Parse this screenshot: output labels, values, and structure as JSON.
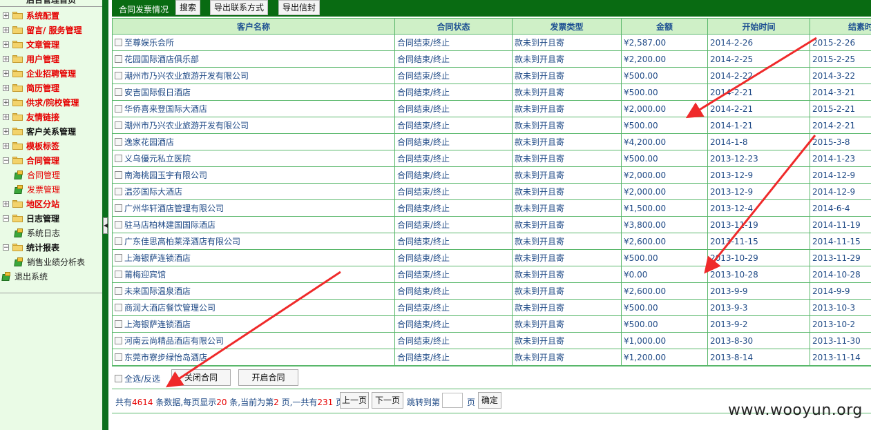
{
  "sidebar": {
    "top_title": "后台管理首页",
    "items": [
      {
        "label": "系统配置",
        "expanded": false,
        "color": "red"
      },
      {
        "label": "留言/ 服务管理",
        "expanded": false,
        "color": "red"
      },
      {
        "label": "文章管理",
        "expanded": false,
        "color": "red"
      },
      {
        "label": "用户管理",
        "expanded": false,
        "color": "red"
      },
      {
        "label": "企业招聘管理",
        "expanded": false,
        "color": "red"
      },
      {
        "label": "简历管理",
        "expanded": false,
        "color": "red"
      },
      {
        "label": "供求/院校管理",
        "expanded": false,
        "color": "red"
      },
      {
        "label": "友情链接",
        "expanded": false,
        "color": "red"
      },
      {
        "label": "客户关系管理",
        "expanded": false,
        "color": "black"
      },
      {
        "label": "模板标签",
        "expanded": false,
        "color": "red"
      },
      {
        "label": "合同管理",
        "expanded": true,
        "color": "red",
        "children": [
          {
            "label": "合同管理",
            "color": "red"
          },
          {
            "label": "发票管理",
            "color": "red"
          }
        ]
      },
      {
        "label": "地区分站",
        "expanded": false,
        "color": "red"
      },
      {
        "label": "日志管理",
        "expanded": true,
        "color": "black",
        "children": [
          {
            "label": "系统日志",
            "color": "black"
          }
        ]
      },
      {
        "label": "统计报表",
        "expanded": true,
        "color": "black",
        "children": [
          {
            "label": "销售业绩分析表",
            "color": "black"
          }
        ]
      }
    ],
    "logout": "退出系统"
  },
  "toolbar": {
    "title": "合同发票情况",
    "search_label": "搜索",
    "export_contacts_label": "导出联系方式",
    "export_envelope_label": "导出信封"
  },
  "table": {
    "columns": [
      "客户名称",
      "合同状态",
      "发票类型",
      "金额",
      "开始时间",
      "结素时"
    ],
    "rows": [
      [
        "至尊娱乐会所",
        "合同结束/终止",
        "款未到开且寄",
        "¥2,587.00",
        "2014-2-26",
        "2015-2-26"
      ],
      [
        "花园国际酒店俱乐部",
        "合同结束/终止",
        "款未到开且寄",
        "¥2,200.00",
        "2014-2-25",
        "2015-2-25"
      ],
      [
        "潮州市乃兴农业旅游开发有限公司",
        "合同结束/终止",
        "款未到开且寄",
        "¥500.00",
        "2014-2-22",
        "2014-3-22"
      ],
      [
        "安吉国际假日酒店",
        "合同结束/终止",
        "款未到开且寄",
        "¥500.00",
        "2014-2-21",
        "2014-3-21"
      ],
      [
        "华侨喜来登国际大酒店",
        "合同结束/终止",
        "款未到开且寄",
        "¥2,000.00",
        "2014-2-21",
        "2015-2-21"
      ],
      [
        "潮州市乃兴农业旅游开发有限公司",
        "合同结束/终止",
        "款未到开且寄",
        "¥500.00",
        "2014-1-21",
        "2014-2-21"
      ],
      [
        "逸家花园酒店",
        "合同结束/终止",
        "款未到开且寄",
        "¥4,200.00",
        "2014-1-8",
        "2015-3-8"
      ],
      [
        "义乌優元私立医院",
        "合同结束/终止",
        "款未到开且寄",
        "¥500.00",
        "2013-12-23",
        "2014-1-23"
      ],
      [
        "南海桃园玉宇有限公司",
        "合同结束/终止",
        "款未到开且寄",
        "¥2,000.00",
        "2013-12-9",
        "2014-12-9"
      ],
      [
        "温莎国际大酒店",
        "合同结束/终止",
        "款未到开且寄",
        "¥2,000.00",
        "2013-12-9",
        "2014-12-9"
      ],
      [
        "广州华轩酒店管理有限公司",
        "合同结束/终止",
        "款未到开且寄",
        "¥1,500.00",
        "2013-12-4",
        "2014-6-4"
      ],
      [
        "驻马店柏林建国国际酒店",
        "合同结束/终止",
        "款未到开且寄",
        "¥3,800.00",
        "2013-11-19",
        "2014-11-19"
      ],
      [
        "广东佳思高柏莱泽酒店有限公司",
        "合同结束/终止",
        "款未到开且寄",
        "¥2,600.00",
        "2013-11-15",
        "2014-11-15"
      ],
      [
        "上海银萨连锁酒店",
        "合同结束/终止",
        "款未到开且寄",
        "¥500.00",
        "2013-10-29",
        "2013-11-29"
      ],
      [
        "莆梅迎宾馆",
        "合同结束/终止",
        "款未到开且寄",
        "¥0.00",
        "2013-10-28",
        "2014-10-28"
      ],
      [
        "未来国际温泉酒店",
        "合同结束/终止",
        "款未到开且寄",
        "¥2,600.00",
        "2013-9-9",
        "2014-9-9"
      ],
      [
        "商润大酒店餐饮管理公司",
        "合同结束/终止",
        "款未到开且寄",
        "¥500.00",
        "2013-9-3",
        "2013-10-3"
      ],
      [
        "上海银萨连锁酒店",
        "合同结束/终止",
        "款未到开且寄",
        "¥500.00",
        "2013-9-2",
        "2013-10-2"
      ],
      [
        "河南云尚精品酒店有限公司",
        "合同结束/终止",
        "款未到开且寄",
        "¥1,000.00",
        "2013-8-30",
        "2013-11-30"
      ],
      [
        "东莞市寮步绿怡岛酒店",
        "合同结束/终止",
        "款未到开且寄",
        "¥1,200.00",
        "2013-8-14",
        "2013-11-14"
      ]
    ]
  },
  "bulk": {
    "select_all_label": "全选/反选",
    "close_contract_label": "关闭合同",
    "open_contract_label": "开启合同"
  },
  "pager": {
    "p1": "共有",
    "total_records": "4614",
    "p2": " 条数据,每页显示",
    "per_page": "20",
    "p3": " 条,当前为第",
    "current_page": "2",
    "p4": " 页,一共有",
    "total_pages": "231",
    "p5": " 页",
    "prev_label": "上一页",
    "next_label": "下一页",
    "jump_label": "跳转到第",
    "page_suffix": "页",
    "confirm_label": "确定"
  },
  "watermark": "www.wooyun.org",
  "colors": {
    "sidebar_bg": "#eafbe6",
    "toolbar_bg": "#096b12",
    "header_bg": "#cff0c7",
    "grid_border": "#58b76a",
    "highlight_red": "#e60000",
    "annotation_arrow": "#ef2a2a"
  }
}
